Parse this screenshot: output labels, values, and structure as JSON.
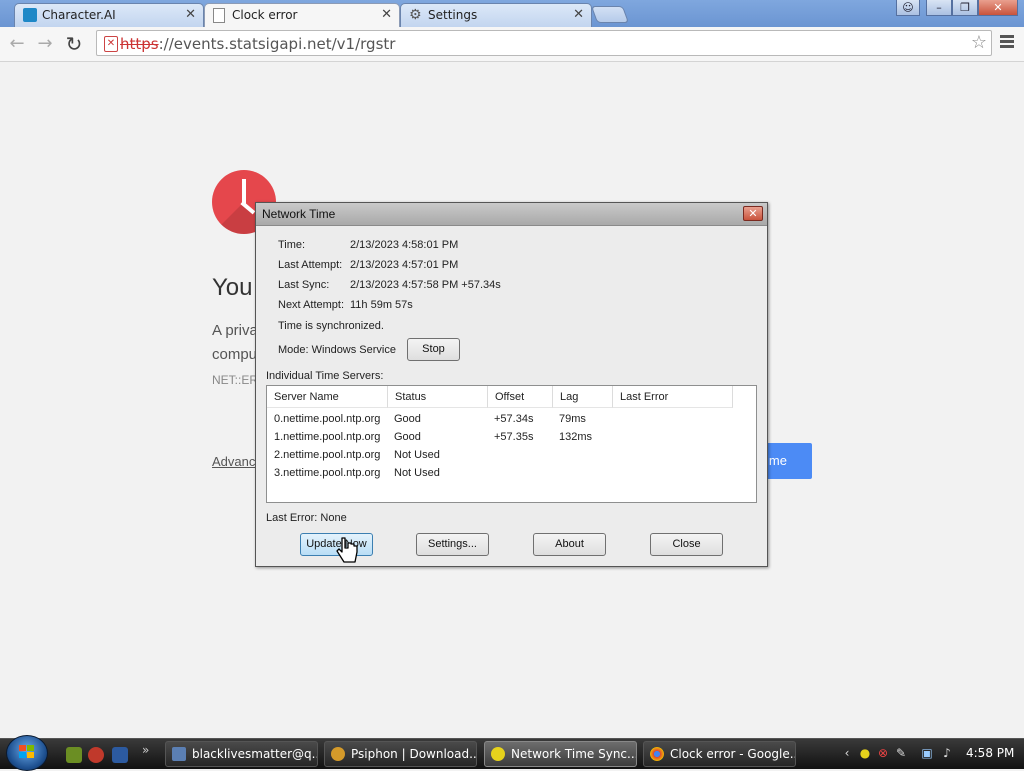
{
  "browser": {
    "tabs": [
      {
        "label": "Character.AI",
        "active": false
      },
      {
        "label": "Clock error",
        "active": true
      },
      {
        "label": "Settings",
        "active": false
      }
    ],
    "url_scheme": "https",
    "url_rest": "://events.statsigapi.net/v1/rgstr"
  },
  "page": {
    "title": "You",
    "line1": "A priva",
    "line2": "compu",
    "error_code": "NET::ER",
    "advanced_link": "Advanc",
    "button_tail": "ime",
    "colors": {
      "clock_red": "#e5474c",
      "button_blue": "#4c8bf5"
    }
  },
  "dialog": {
    "title": "Network Time",
    "fields": [
      {
        "label": "Time:",
        "value": "2/13/2023 4:58:01 PM"
      },
      {
        "label": "Last Attempt:",
        "value": "2/13/2023 4:57:01 PM"
      },
      {
        "label": "Last Sync:",
        "value": "2/13/2023 4:57:58 PM +57.34s"
      },
      {
        "label": "Next Attempt:",
        "value": "11h 59m 57s"
      }
    ],
    "status": "Time is synchronized.",
    "mode_label": "Mode: Windows Service",
    "stop_button": "Stop",
    "servers_label": "Individual Time Servers:",
    "columns": [
      "Server Name",
      "Status",
      "Offset",
      "Lag",
      "Last Error"
    ],
    "servers": [
      {
        "name": "0.nettime.pool.ntp.org",
        "status": "Good",
        "offset": "+57.34s",
        "lag": "79ms",
        "error": ""
      },
      {
        "name": "1.nettime.pool.ntp.org",
        "status": "Good",
        "offset": "+57.35s",
        "lag": "132ms",
        "error": ""
      },
      {
        "name": "2.nettime.pool.ntp.org",
        "status": "Not Used",
        "offset": "",
        "lag": "",
        "error": ""
      },
      {
        "name": "3.nettime.pool.ntp.org",
        "status": "Not Used",
        "offset": "",
        "lag": "",
        "error": ""
      }
    ],
    "last_error": "Last Error:  None",
    "buttons": {
      "update": "Update Now",
      "settings": "Settings...",
      "about": "About",
      "close": "Close"
    }
  },
  "taskbar": {
    "items": [
      {
        "label": "blacklivesmatter@q...",
        "active": false
      },
      {
        "label": "Psiphon | Download...",
        "active": false
      },
      {
        "label": "Network Time Sync...",
        "active": true
      },
      {
        "label": "Clock error - Google...",
        "active": false
      }
    ],
    "clock": "4:58 PM"
  }
}
